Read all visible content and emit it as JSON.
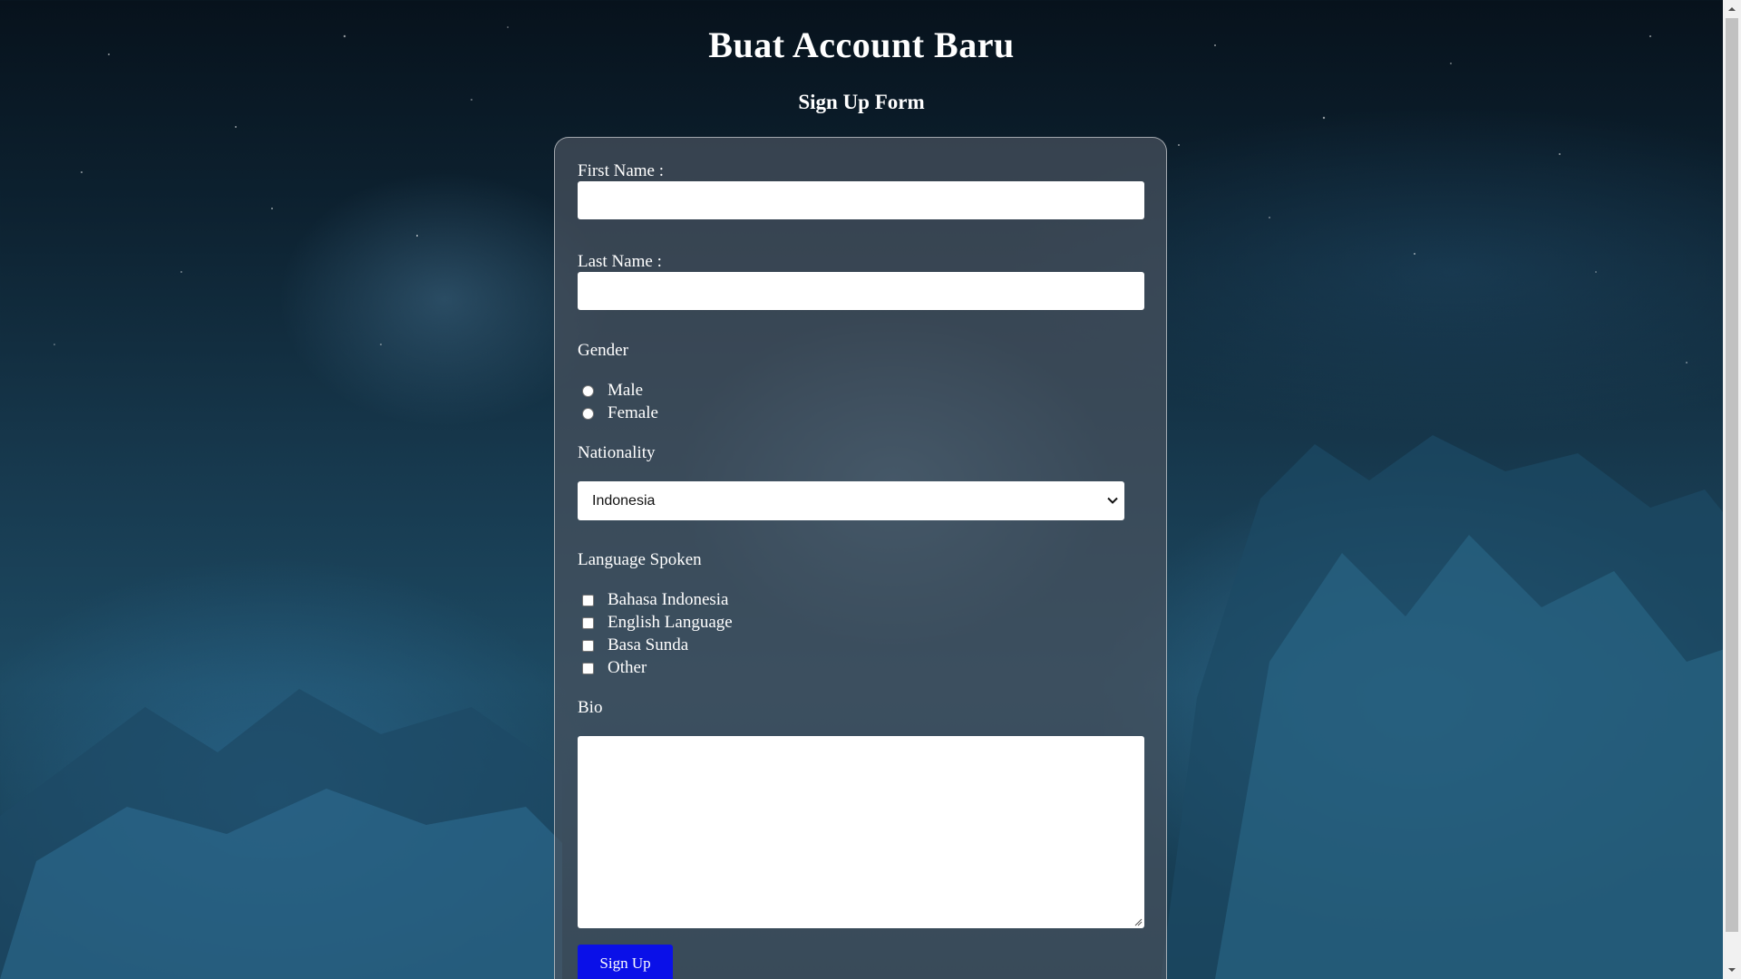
{
  "page": {
    "title": "Buat Account Baru",
    "subtitle": "Sign Up Form"
  },
  "form": {
    "first_name": {
      "label": "First Name :",
      "value": ""
    },
    "last_name": {
      "label": "Last Name :",
      "value": ""
    },
    "gender": {
      "label": "Gender",
      "options": [
        "Male",
        "Female"
      ]
    },
    "nationality": {
      "label": "Nationality",
      "selected": "Indonesia"
    },
    "languages": {
      "label": "Language Spoken",
      "options": [
        "Bahasa Indonesia",
        "English Language",
        "Basa Sunda",
        "Other"
      ]
    },
    "bio": {
      "label": "Bio",
      "value": ""
    },
    "submit_label": "Sign Up"
  },
  "icons": {
    "select_chevron": "chevron-down-icon",
    "textarea_resize": "resize-grip-icon",
    "scroll_up": "scroll-up-arrow-icon",
    "scroll_down": "scroll-down-arrow-icon"
  },
  "colors": {
    "button_bg": "#0a10e8",
    "card_bg": "#48525e",
    "text": "#ffffff"
  }
}
